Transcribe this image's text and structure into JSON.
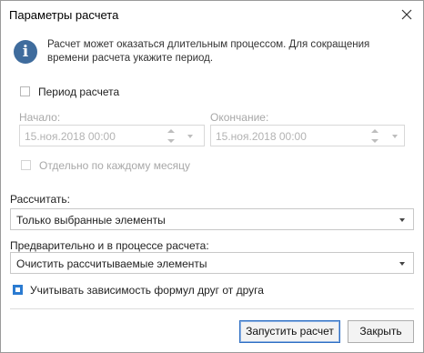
{
  "dialog": {
    "title": "Параметры расчета",
    "info_text": "Расчет может оказаться длительным процессом. Для сокращения времени расчета укажите период."
  },
  "period": {
    "checkbox_label": "Период расчета",
    "checked": false,
    "start_label": "Начало:",
    "start_value": "15.ноя.2018 00:00",
    "end_label": "Окончание:",
    "end_value": "15.ноя.2018 00:00",
    "monthly_label": "Отдельно по каждому месяцу",
    "monthly_checked": false
  },
  "calculate": {
    "label": "Рассчитать:",
    "selected": "Только выбранные элементы"
  },
  "pre_process": {
    "label": "Предварительно и в процессе расчета:",
    "selected": "Очистить рассчитываемые элементы"
  },
  "dependencies": {
    "label": "Учитывать зависимость формул друг от друга",
    "checked": true
  },
  "buttons": {
    "run": "Запустить расчет",
    "close": "Закрыть"
  },
  "colors": {
    "accent": "#2b7bd1",
    "info_icon": "#3f6c9d"
  }
}
